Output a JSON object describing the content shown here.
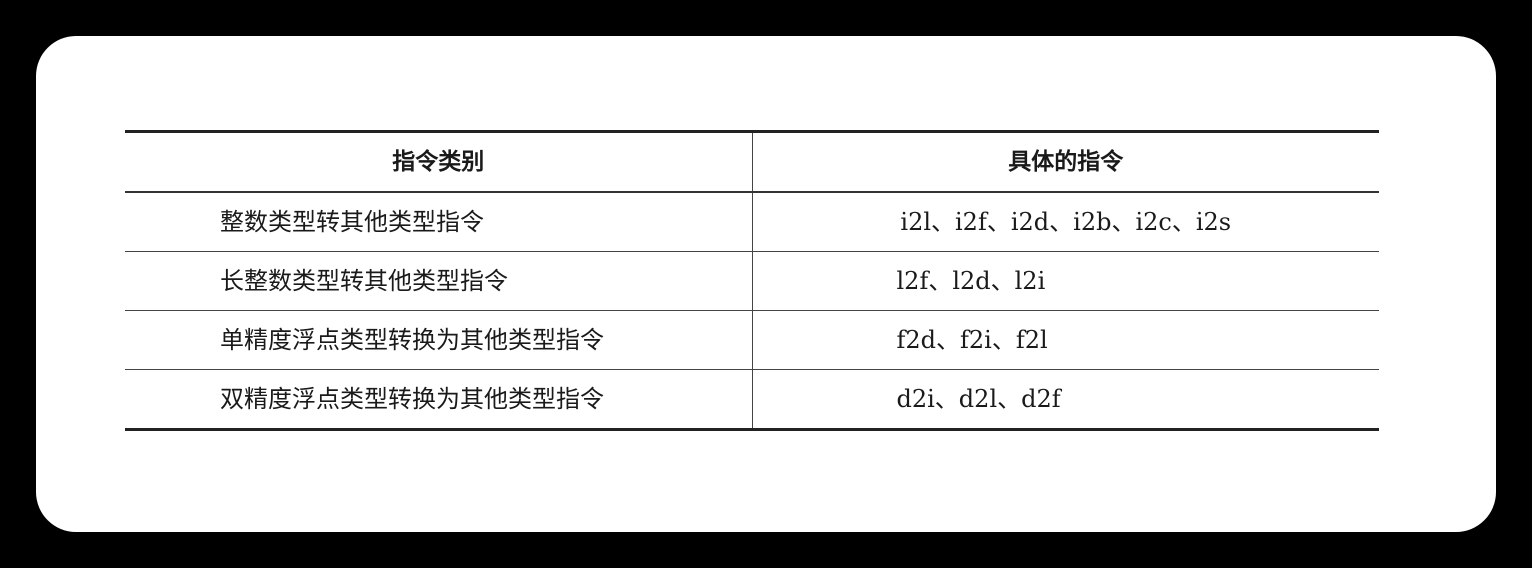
{
  "table": {
    "headers": [
      "指令类别",
      "具体的指令"
    ],
    "rows": [
      {
        "category": "整数类型转其他类型指令",
        "instructions": "i2l、i2f、i2d、i2b、i2c、i2s"
      },
      {
        "category": "长整数类型转其他类型指令",
        "instructions": "l2f、l2d、l2i"
      },
      {
        "category": "单精度浮点类型转换为其他类型指令",
        "instructions": "f2d、f2i、f2l"
      },
      {
        "category": "双精度浮点类型转换为其他类型指令",
        "instructions": "d2i、d2l、d2f"
      }
    ]
  }
}
